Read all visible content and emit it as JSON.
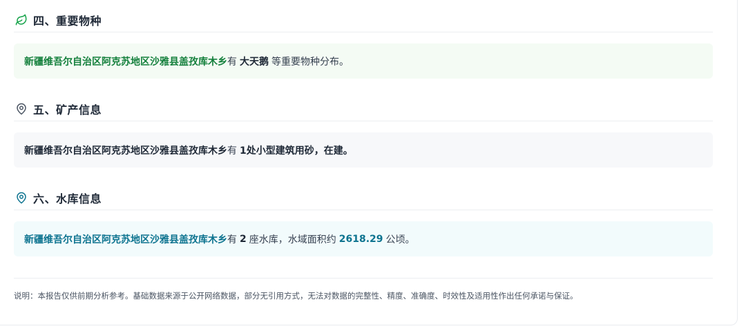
{
  "colors": {
    "green_accent": "#15803d",
    "teal_accent": "#0e7490",
    "icon_green": "#16a34a",
    "icon_gray": "#4b5563",
    "icon_teal": "#0e7490"
  },
  "sections": [
    {
      "icon": "leaf-icon",
      "title": "四、重要物种",
      "region": "新疆维吾尔自治区阿克苏地区沙雅县盖孜库木乡",
      "has": "有",
      "highlight": "大天鹅",
      "suffix": "等重要物种分布。"
    },
    {
      "icon": "location-pin-icon",
      "title": "五、矿产信息",
      "region": "新疆维吾尔自治区阿克苏地区沙雅县盖孜库木乡",
      "has": "有",
      "highlight": "1处小型建筑用砂，在建。"
    },
    {
      "icon": "location-pin-icon",
      "title": "六、水库信息",
      "region": "新疆维吾尔自治区阿克苏地区沙雅县盖孜库木乡",
      "has": "有",
      "count": "2",
      "count_suffix": "座水库，水域面积约",
      "area": "2618.29",
      "area_unit": "公顷。"
    }
  ],
  "footer": {
    "note": "说明：本报告仅供前期分析参考。基础数据来源于公开网络数据，部分无引用方式，无法对数据的完整性、精度、准确度、时效性及适用性作出任何承诺与保证。"
  }
}
